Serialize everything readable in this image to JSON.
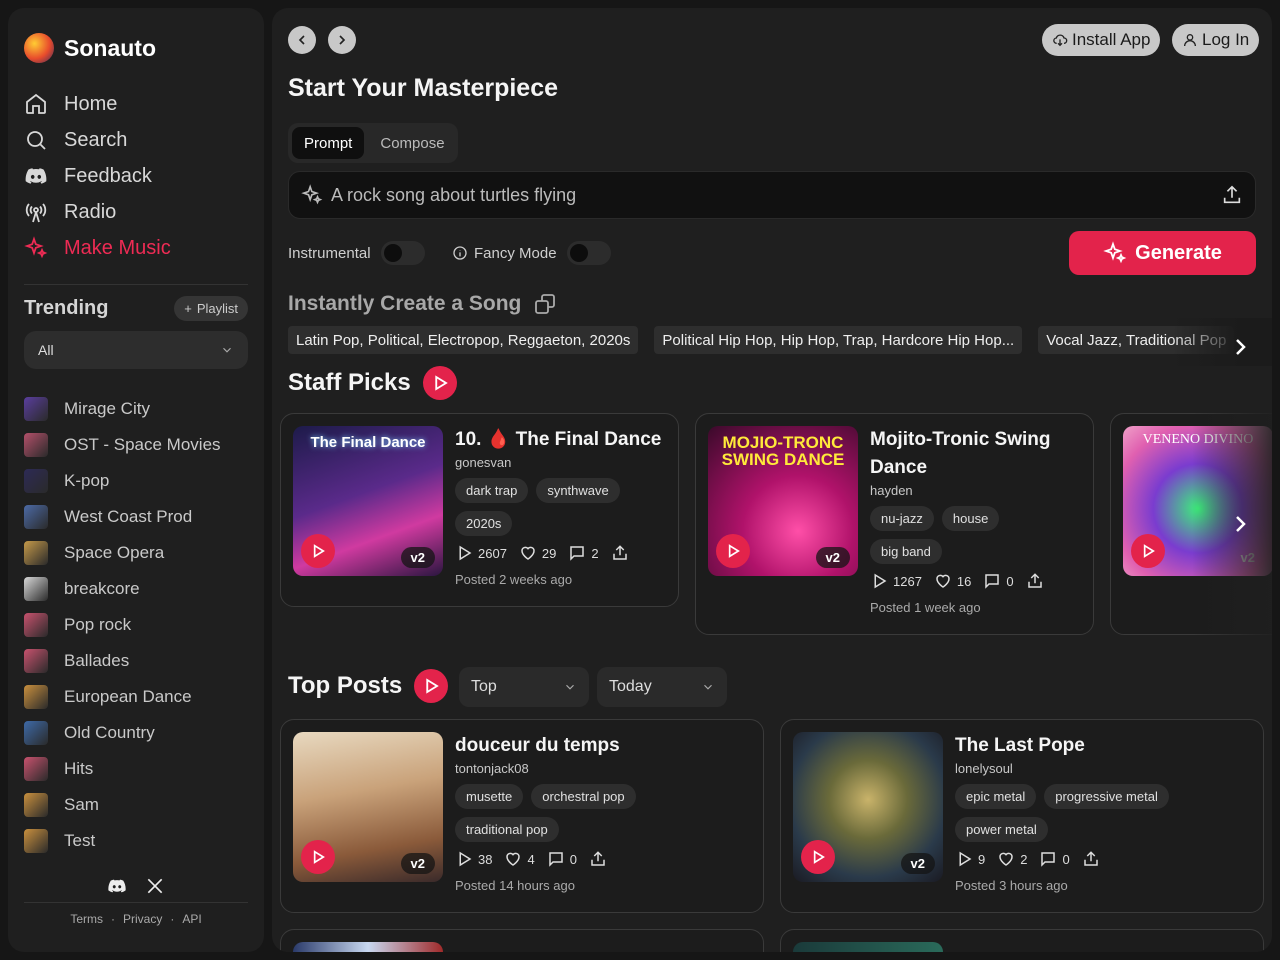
{
  "brand": {
    "name": "Sonauto"
  },
  "nav": [
    {
      "label": "Home",
      "icon": "home-icon"
    },
    {
      "label": "Search",
      "icon": "search-icon"
    },
    {
      "label": "Feedback",
      "icon": "discord-icon"
    },
    {
      "label": "Radio",
      "icon": "radio-icon"
    },
    {
      "label": "Make Music",
      "icon": "sparkle-icon",
      "active": true
    }
  ],
  "trending": {
    "title": "Trending",
    "playlist_button": "Playlist",
    "filter_value": "All",
    "items": [
      {
        "label": "Mirage City",
        "color": "#5a3e9e"
      },
      {
        "label": "OST - Space Movies",
        "color": "#b4506a"
      },
      {
        "label": "K-pop",
        "color": "#2d2a55"
      },
      {
        "label": "West Coast Prod",
        "color": "#4c6aa6"
      },
      {
        "label": "Space Opera",
        "color": "#c59a4a"
      },
      {
        "label": "breakcore",
        "color": "#d8d8d8"
      },
      {
        "label": "Pop rock",
        "color": "#c8526e"
      },
      {
        "label": "Ballades",
        "color": "#c8526e"
      },
      {
        "label": "European Dance",
        "color": "#c9903e"
      },
      {
        "label": "Old Country",
        "color": "#3e6aa8"
      },
      {
        "label": "Hits",
        "color": "#c8526e"
      },
      {
        "label": "Sam",
        "color": "#c9903e"
      },
      {
        "label": "Test",
        "color": "#c9903e"
      }
    ]
  },
  "footer": {
    "terms": "Terms",
    "privacy": "Privacy",
    "api": "API",
    "dot": "·"
  },
  "header": {
    "install": "Install App",
    "login": "Log In"
  },
  "creator": {
    "title": "Start Your Masterpiece",
    "tab_prompt": "Prompt",
    "tab_compose": "Compose",
    "placeholder": "A rock song about turtles flying",
    "instrumental": "Instrumental",
    "fancy": "Fancy Mode",
    "generate": "Generate"
  },
  "instant": {
    "title": "Instantly Create a Song",
    "chips": [
      "Latin Pop, Political, Electropop, Reggaeton, 2020s",
      "Political Hip Hop, Hip Hop, Trap, Hardcore Hip Hop...",
      "Vocal Jazz, Traditional Pop"
    ]
  },
  "staff": {
    "title": "Staff Picks",
    "cards": [
      {
        "title": "10. 🩸 The Final Dance",
        "author": "gonesvan",
        "tags": [
          "dark trap",
          "synthwave",
          "2020s"
        ],
        "plays": "2607",
        "likes": "29",
        "comments": "2",
        "posted": "Posted 2 weeks ago",
        "version": "v2",
        "cover_text": "The Final Dance"
      },
      {
        "title": "Mojito-Tronic Swing Dance",
        "author": "hayden",
        "tags": [
          "nu-jazz",
          "house",
          "big band"
        ],
        "plays": "1267",
        "likes": "16",
        "comments": "0",
        "posted": "Posted 1 week ago",
        "version": "v2",
        "cover_text": "MOJIO-TRONC SWING DANCE"
      },
      {
        "version": "v2",
        "cover_text": "VENENO DIVINO"
      }
    ]
  },
  "top": {
    "title": "Top Posts",
    "sort": "Top",
    "range": "Today",
    "cards": [
      {
        "title": "douceur du temps",
        "author": "tontonjack08",
        "tags": [
          "musette",
          "orchestral pop",
          "traditional pop"
        ],
        "plays": "38",
        "likes": "4",
        "comments": "0",
        "posted": "Posted 14 hours ago",
        "version": "v2"
      },
      {
        "title": "The Last Pope",
        "author": "lonelysoul",
        "tags": [
          "epic metal",
          "progressive metal",
          "power metal"
        ],
        "plays": "9",
        "likes": "2",
        "comments": "0",
        "posted": "Posted 3 hours ago",
        "version": "v2"
      }
    ]
  }
}
